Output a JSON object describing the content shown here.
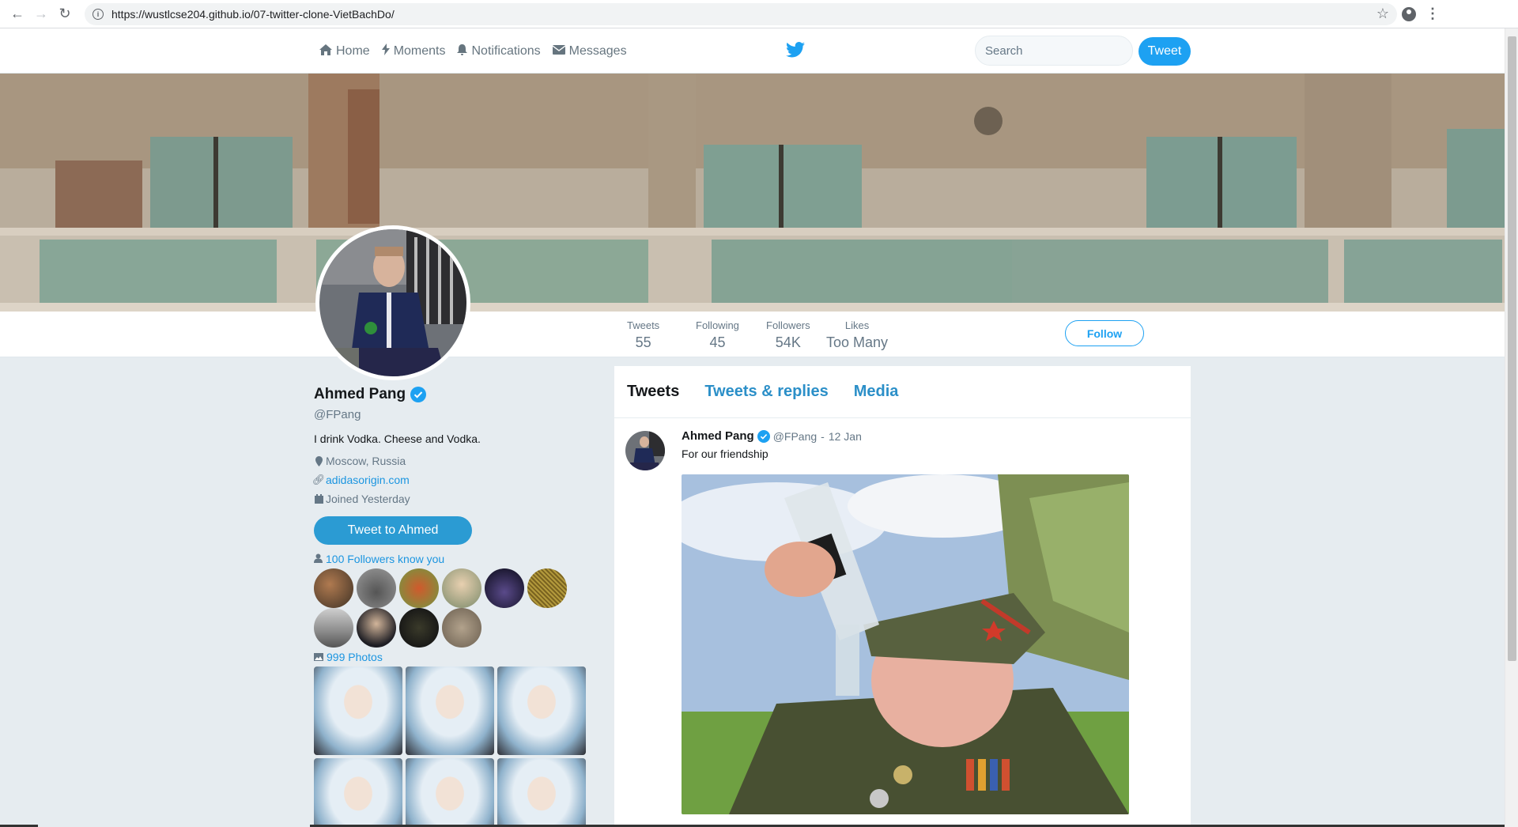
{
  "browser": {
    "url": "https://wustlcse204.github.io/07-twitter-clone-VietBachDo/"
  },
  "topnav": {
    "items": [
      {
        "label": "Home",
        "icon": "home-icon"
      },
      {
        "label": "Moments",
        "icon": "bolt-icon"
      },
      {
        "label": "Notifications",
        "icon": "bell-icon"
      },
      {
        "label": "Messages",
        "icon": "envelope-icon"
      }
    ],
    "search_placeholder": "Search",
    "tweet_button": "Tweet"
  },
  "stats": {
    "tweets": {
      "label": "Tweets",
      "value": "55"
    },
    "following": {
      "label": "Following",
      "value": "45"
    },
    "followers": {
      "label": "Followers",
      "value": "54K"
    },
    "likes": {
      "label": "Likes",
      "value": "Too Many"
    },
    "follow_button": "Follow"
  },
  "profile": {
    "name": "Ahmed Pang",
    "handle": "@FPang",
    "bio": "I drink Vodka. Cheese and Vodka.",
    "location": "Moscow, Russia",
    "website": "adidasorigin.com",
    "joined": "Joined Yesterday",
    "tweet_to_button": "Tweet to Ahmed",
    "followers_know": "100 Followers know you",
    "photos_link": "999 Photos"
  },
  "timeline": {
    "tabs": [
      "Tweets",
      "Tweets & replies",
      "Media"
    ],
    "active_tab": "Tweets",
    "tweet": {
      "name": "Ahmed Pang",
      "handle": "@FPang",
      "separator": "-",
      "time": "12 Jan",
      "text": "For our friendship"
    }
  },
  "colors": {
    "accent": "#1da1f2",
    "link": "#1b95e0",
    "background": "#e6ecf0"
  }
}
